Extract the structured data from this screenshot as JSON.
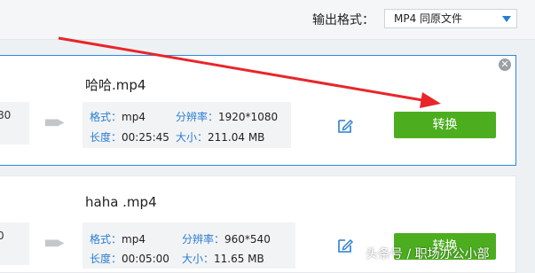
{
  "header": {
    "format_label": "输出格式：",
    "format_value": "MP4  同原文件"
  },
  "files": [
    {
      "partial_left_value": "80",
      "name": "哈哈.mp4",
      "format_key": "格式：",
      "format_val": "mp4",
      "res_key": "分辨率：",
      "res_val": "1920*1080",
      "len_key": "长度：",
      "len_val": "00:25:45",
      "size_key": "大小：",
      "size_val": "211.04 MB",
      "convert_label": "转换"
    },
    {
      "partial_left_value": "0",
      "name": "haha .mp4",
      "format_key": "格式：",
      "format_val": "mp4",
      "res_key": "分辨率：",
      "res_val": "960*540",
      "len_key": "长度：",
      "len_val": "00:05:00",
      "size_key": "大小：",
      "size_val": "11.65 MB",
      "convert_label": "转换"
    }
  ],
  "watermark": "头条号 / 职场办公小部",
  "colors": {
    "accent_blue": "#2a7dd1",
    "card_border": "#2d88dd",
    "convert_green": "#4cae1f",
    "annotation_red": "#e8262a"
  }
}
